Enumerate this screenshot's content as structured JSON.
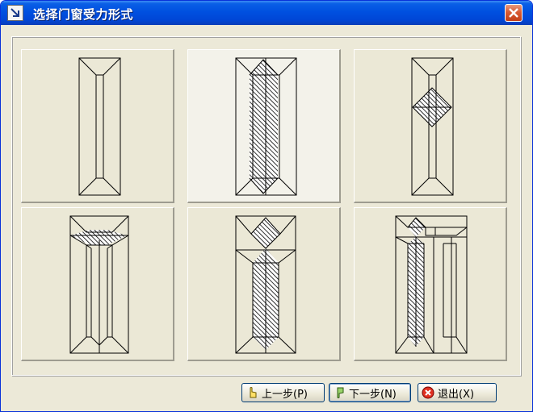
{
  "window": {
    "title": "选择门窗受力形式"
  },
  "buttons": {
    "prev": "上一步(P)",
    "next": "下一步(N)",
    "exit": "退出(X)"
  },
  "panels": [
    {
      "name": "option-1",
      "selected": false
    },
    {
      "name": "option-2",
      "selected": true
    },
    {
      "name": "option-3",
      "selected": false
    },
    {
      "name": "option-4",
      "selected": false
    },
    {
      "name": "option-5",
      "selected": false
    },
    {
      "name": "option-6",
      "selected": false
    }
  ],
  "colors": {
    "titlebar": "#0050e0",
    "panel": "#ebe8d6",
    "panel_selected": "#f3f2ea",
    "dialog": "#ece9d8"
  },
  "icons": {
    "app": "arrow-down-right-icon",
    "close": "close-icon",
    "prev": "hand-pointing-up-icon",
    "next": "hand-pointing-down-icon",
    "exit": "stop-icon"
  }
}
